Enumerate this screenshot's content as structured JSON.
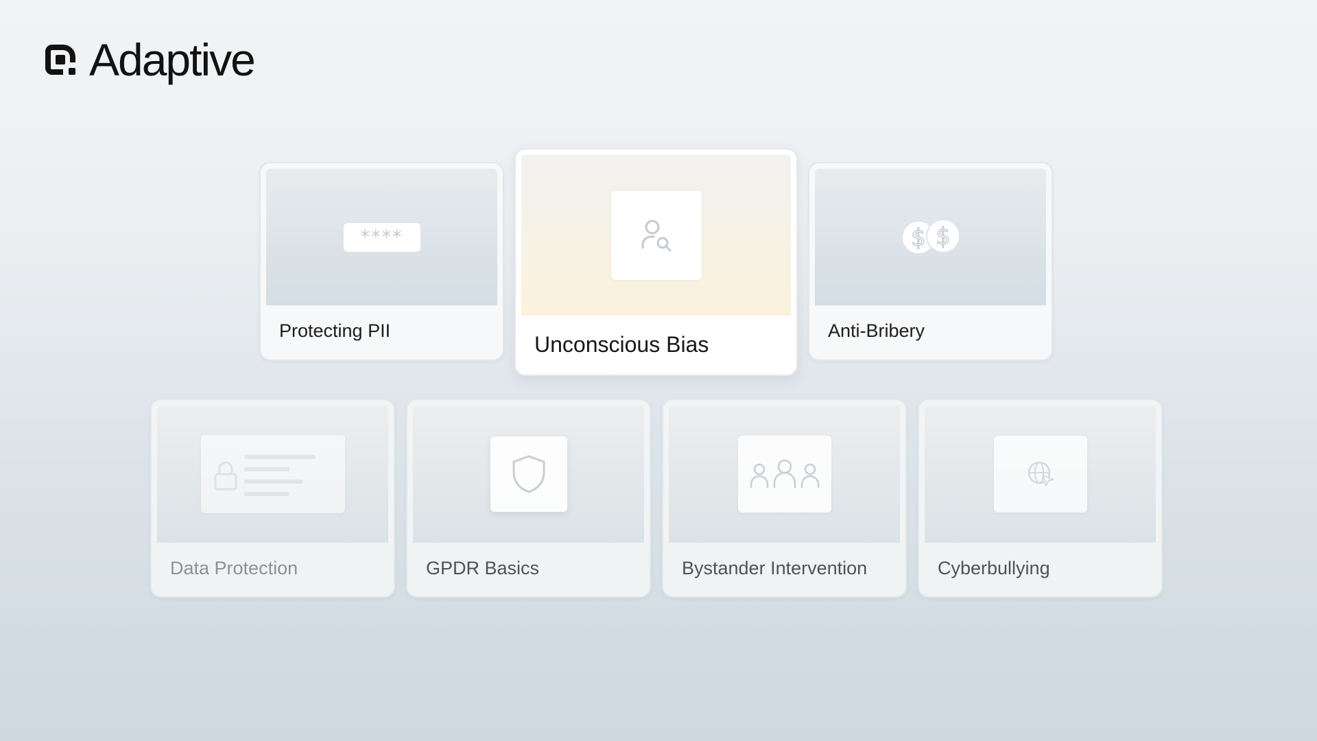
{
  "brand": {
    "name": "Adaptive",
    "logo_icon": "adaptive-logo-icon"
  },
  "featured": {
    "title": "Unconscious Bias",
    "icon": "person-search-icon"
  },
  "top_row": [
    {
      "title": "Protecting PII",
      "icon": "password-field-icon",
      "masked_text": "****"
    },
    {
      "title": "Anti-Bribery",
      "icon": "dollar-coins-icon"
    }
  ],
  "bottom_row": [
    {
      "title": "Data Protection",
      "icon": "locked-document-icon"
    },
    {
      "title": "GPDR Basics",
      "icon": "shield-icon"
    },
    {
      "title": "Bystander Intervention",
      "icon": "people-group-icon"
    },
    {
      "title": "Cyberbullying",
      "icon": "globe-cursor-icon"
    }
  ],
  "colors": {
    "background_top": "#f2f3f5",
    "background_bottom": "#cdd8df",
    "featured_accent": "#fbf2dc",
    "text_primary": "#1c1c1c",
    "icon_stroke": "#c7ced4"
  }
}
